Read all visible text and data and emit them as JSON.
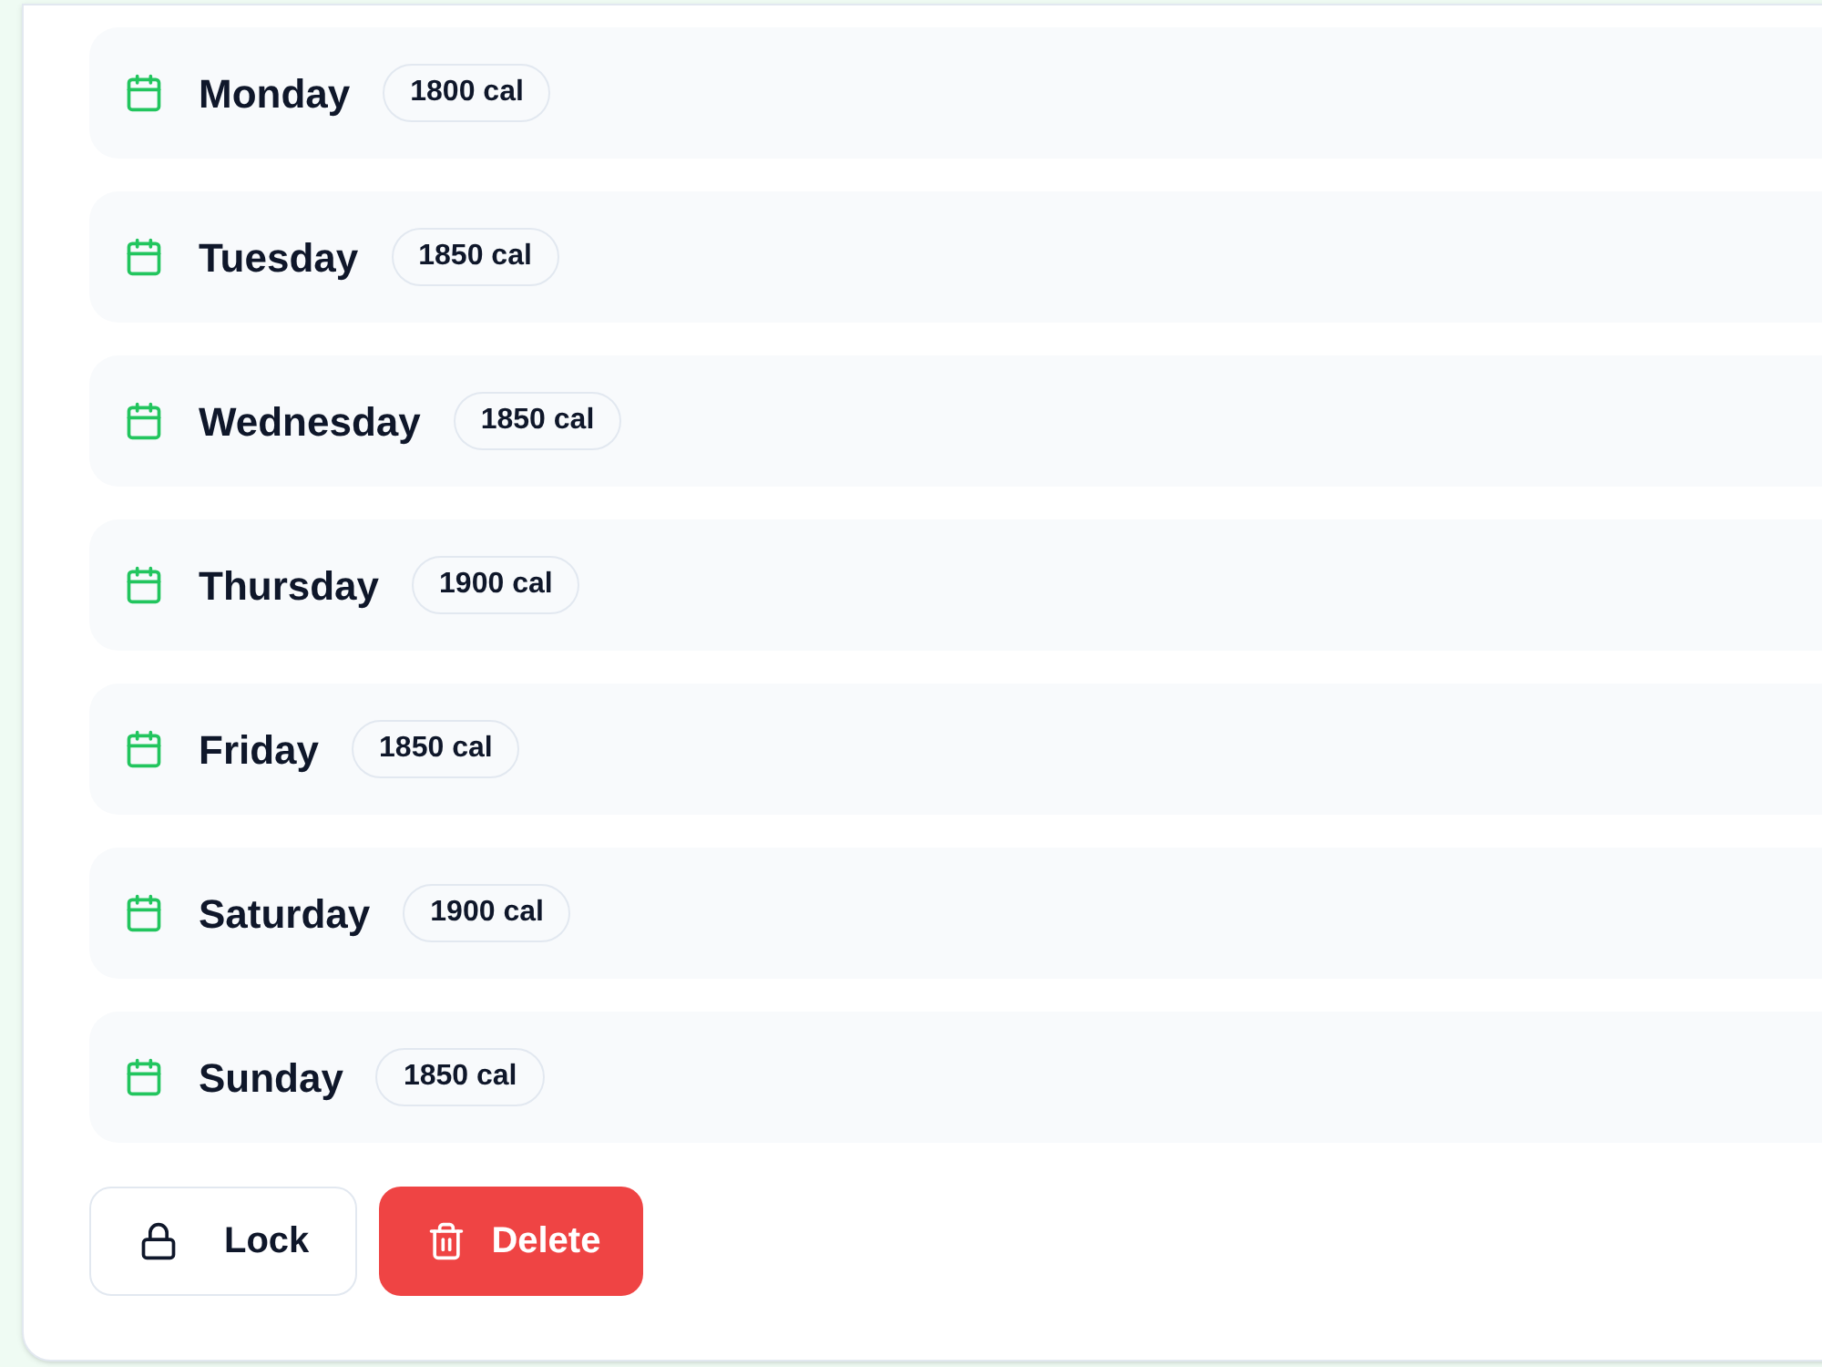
{
  "days": [
    {
      "name": "Monday",
      "calories": "1800 cal"
    },
    {
      "name": "Tuesday",
      "calories": "1850 cal"
    },
    {
      "name": "Wednesday",
      "calories": "1850 cal"
    },
    {
      "name": "Thursday",
      "calories": "1900 cal"
    },
    {
      "name": "Friday",
      "calories": "1850 cal"
    },
    {
      "name": "Saturday",
      "calories": "1900 cal"
    },
    {
      "name": "Sunday",
      "calories": "1850 cal"
    }
  ],
  "actions": [
    {
      "label": "Lock",
      "kind": "secondary"
    },
    {
      "label": "Delete",
      "kind": "danger"
    }
  ]
}
